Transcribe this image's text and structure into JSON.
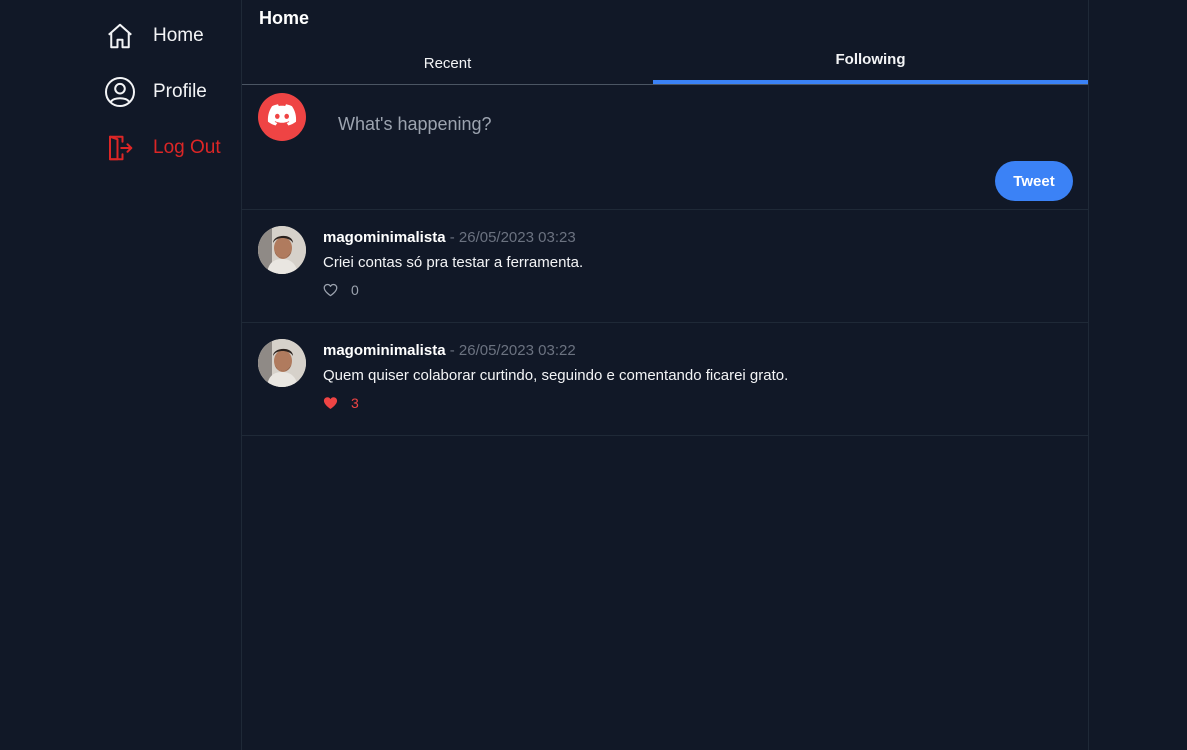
{
  "sidebar": {
    "items": [
      {
        "label": "Home",
        "icon": "home-icon"
      },
      {
        "label": "Profile",
        "icon": "user-circle-icon"
      },
      {
        "label": "Log Out",
        "icon": "logout-door-icon",
        "color": "#dc2626"
      }
    ]
  },
  "header": {
    "title": "Home"
  },
  "tabs": [
    {
      "label": "Recent",
      "active": false
    },
    {
      "label": "Following",
      "active": true
    }
  ],
  "composer": {
    "placeholder": "What's happening?",
    "avatar_icon": "discord-logo-icon",
    "tweet_label": "Tweet"
  },
  "posts": [
    {
      "author": "magominimalista",
      "separator": " - ",
      "date": "26/05/2023 03:23",
      "text": "Criei contas só pra testar a ferramenta.",
      "likes": "0",
      "liked": false
    },
    {
      "author": "magominimalista",
      "separator": " - ",
      "date": "26/05/2023 03:22",
      "text": "Quem quiser colaborar curtindo, seguindo e comentando ficarei grato.",
      "likes": "3",
      "liked": true
    }
  ],
  "colors": {
    "background": "#111827",
    "accent": "#3b82f6",
    "danger": "#ef4444",
    "logout": "#dc2626"
  }
}
